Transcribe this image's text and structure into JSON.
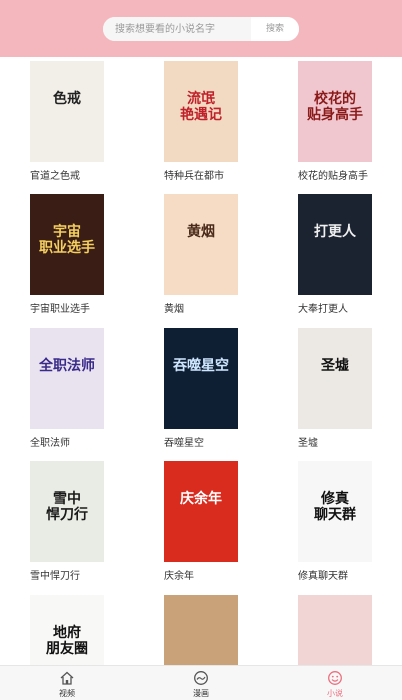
{
  "search": {
    "placeholder": "搜索想要看的小说名字",
    "button_label": "搜索"
  },
  "books": [
    {
      "title": "官道之色戒",
      "cover_text": "色戒",
      "cover_bg": "#f2efe9",
      "cover_fg": "#222222"
    },
    {
      "title": "特种兵在都市",
      "cover_text": "流氓\n艳遇记",
      "cover_bg": "#f1d9c2",
      "cover_fg": "#c0202a"
    },
    {
      "title": "校花的贴身高手",
      "cover_text": "校花的\n贴身高手",
      "cover_bg": "#f0c7cf",
      "cover_fg": "#8b1a1a"
    },
    {
      "title": "宇宙职业选手",
      "cover_text": "宇宙\n职业选手",
      "cover_bg": "#3a1d14",
      "cover_fg": "#f4d060"
    },
    {
      "title": "黄烟",
      "cover_text": "黄烟",
      "cover_bg": "#f6dcc5",
      "cover_fg": "#4a2a1a"
    },
    {
      "title": "大奉打更人",
      "cover_text": "打更人",
      "cover_bg": "#1b2230",
      "cover_fg": "#f0f0f0"
    },
    {
      "title": "全职法师",
      "cover_text": "全职法师",
      "cover_bg": "#e9e2ef",
      "cover_fg": "#3a2a8a"
    },
    {
      "title": "吞噬星空",
      "cover_text": "吞噬星空",
      "cover_bg": "#0e1e33",
      "cover_fg": "#cfe6ff"
    },
    {
      "title": "圣墟",
      "cover_text": "圣墟",
      "cover_bg": "#ece9e5",
      "cover_fg": "#111111"
    },
    {
      "title": "雪中悍刀行",
      "cover_text": "雪中\n悍刀行",
      "cover_bg": "#e9ece4",
      "cover_fg": "#1a1a1a"
    },
    {
      "title": "庆余年",
      "cover_text": "庆余年",
      "cover_bg": "#d92b1e",
      "cover_fg": "#ffffff"
    },
    {
      "title": "修真聊天群",
      "cover_text": "修真\n聊天群",
      "cover_bg": "#f7f7f7",
      "cover_fg": "#111111"
    },
    {
      "title": "",
      "cover_text": "地府\n朋友圈",
      "cover_bg": "#f8f8f6",
      "cover_fg": "#111111"
    },
    {
      "title": "",
      "cover_text": "",
      "cover_bg": "#c9a27a",
      "cover_fg": "#ffffff"
    },
    {
      "title": "",
      "cover_text": "",
      "cover_bg": "#f1d4d4",
      "cover_fg": "#ffffff"
    }
  ],
  "tabs": [
    {
      "label": "视频",
      "icon": "home-icon",
      "active": false
    },
    {
      "label": "漫画",
      "icon": "comic-icon",
      "active": false
    },
    {
      "label": "小说",
      "icon": "smile-icon",
      "active": true
    }
  ],
  "colors": {
    "header": "#f4b7bd",
    "accent": "#ec6f7f"
  }
}
